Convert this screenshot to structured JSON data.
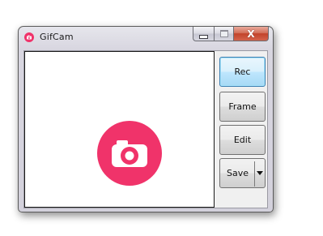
{
  "window": {
    "title": "GifCam",
    "app_icon": "camera-icon",
    "caption_buttons": {
      "minimize": "minimize-icon",
      "maximize": "maximize-icon",
      "close_glyph": "X"
    }
  },
  "capture_area": {
    "logo": "camera-icon",
    "logo_color": "#f0336a",
    "background": "#ffffff"
  },
  "buttons": {
    "rec_label": "Rec",
    "frame_label": "Frame",
    "edit_label": "Edit",
    "save_label": "Save",
    "save_menu_icon": "chevron-down-icon"
  },
  "colors": {
    "accent": "#f0336a",
    "close_button": "#c9452b",
    "focus_border": "#3c7fb1"
  }
}
